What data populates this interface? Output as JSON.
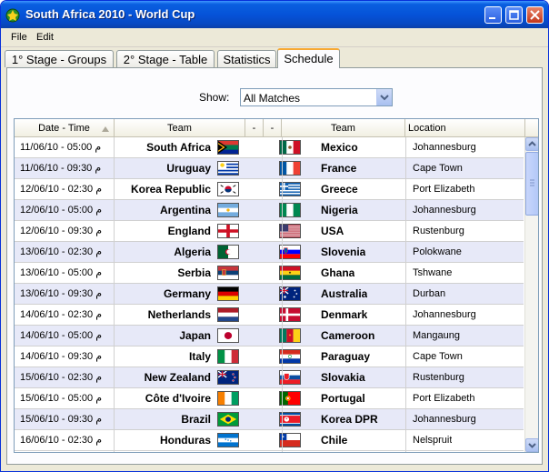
{
  "window": {
    "title": "South Africa 2010 - World Cup"
  },
  "menu": [
    "File",
    "Edit"
  ],
  "tabs": [
    "1° Stage - Groups",
    "2° Stage - Table",
    "Statistics",
    "Schedule"
  ],
  "active_tab": "Schedule",
  "filter": {
    "label": "Show:",
    "value": "All Matches"
  },
  "columns": {
    "date": "Date - Time",
    "home": "Team",
    "dash1": "-",
    "dash2": "-",
    "away": "Team",
    "location": "Location"
  },
  "matches": [
    {
      "date": "11/06/10 - 05:00 م",
      "home": "South Africa",
      "home_flag": "za",
      "away": "Mexico",
      "away_flag": "mx",
      "location": "Johannesburg"
    },
    {
      "date": "11/06/10 - 09:30 م",
      "home": "Uruguay",
      "home_flag": "uy",
      "away": "France",
      "away_flag": "fr",
      "location": "Cape Town"
    },
    {
      "date": "12/06/10 - 02:30 م",
      "home": "Korea Republic",
      "home_flag": "kr",
      "away": "Greece",
      "away_flag": "gr",
      "location": "Port Elizabeth"
    },
    {
      "date": "12/06/10 - 05:00 م",
      "home": "Argentina",
      "home_flag": "ar",
      "away": "Nigeria",
      "away_flag": "ng",
      "location": "Johannesburg"
    },
    {
      "date": "12/06/10 - 09:30 م",
      "home": "England",
      "home_flag": "en",
      "away": "USA",
      "away_flag": "us",
      "location": "Rustenburg"
    },
    {
      "date": "13/06/10 - 02:30 م",
      "home": "Algeria",
      "home_flag": "dz",
      "away": "Slovenia",
      "away_flag": "si",
      "location": "Polokwane"
    },
    {
      "date": "13/06/10 - 05:00 م",
      "home": "Serbia",
      "home_flag": "rs",
      "away": "Ghana",
      "away_flag": "gh",
      "location": "Tshwane"
    },
    {
      "date": "13/06/10 - 09:30 م",
      "home": "Germany",
      "home_flag": "de",
      "away": "Australia",
      "away_flag": "au",
      "location": "Durban"
    },
    {
      "date": "14/06/10 - 02:30 م",
      "home": "Netherlands",
      "home_flag": "nl",
      "away": "Denmark",
      "away_flag": "dk",
      "location": "Johannesburg"
    },
    {
      "date": "14/06/10 - 05:00 م",
      "home": "Japan",
      "home_flag": "jp",
      "away": "Cameroon",
      "away_flag": "cm",
      "location": "Mangaung"
    },
    {
      "date": "14/06/10 - 09:30 م",
      "home": "Italy",
      "home_flag": "it",
      "away": "Paraguay",
      "away_flag": "py",
      "location": "Cape Town"
    },
    {
      "date": "15/06/10 - 02:30 م",
      "home": "New Zealand",
      "home_flag": "nz",
      "away": "Slovakia",
      "away_flag": "sk",
      "location": "Rustenburg"
    },
    {
      "date": "15/06/10 - 05:00 م",
      "home": "Côte d'Ivoire",
      "home_flag": "ci",
      "away": "Portugal",
      "away_flag": "pt",
      "location": "Port Elizabeth"
    },
    {
      "date": "15/06/10 - 09:30 م",
      "home": "Brazil",
      "home_flag": "br",
      "away": "Korea DPR",
      "away_flag": "kp",
      "location": "Johannesburg"
    },
    {
      "date": "16/06/10 - 02:30 م",
      "home": "Honduras",
      "home_flag": "hn",
      "away": "Chile",
      "away_flag": "cl",
      "location": "Nelspruit"
    }
  ]
}
